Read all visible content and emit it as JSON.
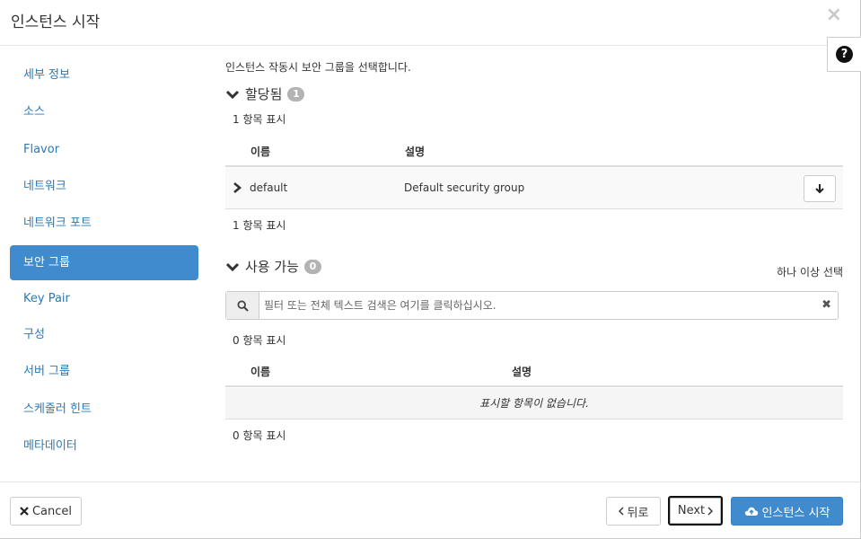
{
  "header": {
    "title": "인스턴스 시작",
    "close": "×",
    "help": "?"
  },
  "sidebar": {
    "items": [
      {
        "label": "세부 정보"
      },
      {
        "label": "소스"
      },
      {
        "label": "Flavor"
      },
      {
        "label": "네트워크"
      },
      {
        "label": "네트워크 포트"
      },
      {
        "label": "보안 그룹",
        "active": true
      },
      {
        "label": "Key Pair"
      },
      {
        "label": "구성"
      },
      {
        "label": "서버 그룹"
      },
      {
        "label": "스케줄러 힌트"
      },
      {
        "label": "메타데이터"
      }
    ]
  },
  "main": {
    "help_text": "인스턴스 작동시 보안 그룹을 선택합니다.",
    "allocated": {
      "title": "할당됨",
      "badge": "1",
      "count_top": "1 항목 표시",
      "count_bottom": "1 항목 표시",
      "columns": [
        "이름",
        "설명"
      ],
      "rows": [
        {
          "name": "default",
          "description": "Default security group"
        }
      ]
    },
    "available": {
      "title": "사용 가능",
      "badge": "0",
      "select_hint": "하나 이상 선택",
      "filter_placeholder": "필터 또는 전체 텍스트 검색은 여기를 클릭하십시오.",
      "count_top": "0 항목 표시",
      "count_bottom": "0 항목 표시",
      "columns": [
        "이름",
        "설명"
      ],
      "empty_text": "표시할 항목이 없습니다."
    }
  },
  "footer": {
    "cancel": "Cancel",
    "back": "뒤로",
    "next": "Next",
    "launch": "인스턴스 시작"
  },
  "colors": {
    "accent": "#3f8bce",
    "link": "#2a7ab6",
    "badge": "#b3b3b3"
  }
}
